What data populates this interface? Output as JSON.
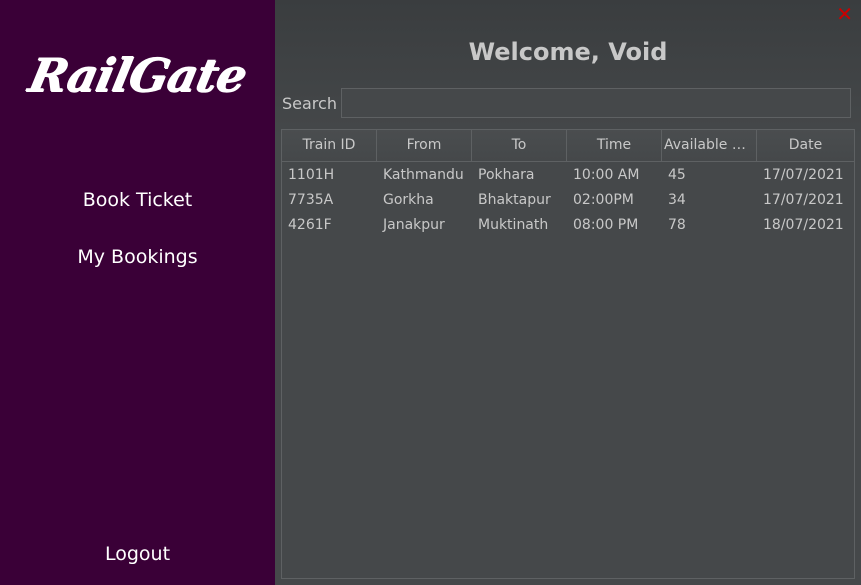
{
  "sidebar": {
    "logo": "RailGate",
    "nav": [
      "Book Ticket",
      "My Bookings"
    ],
    "logout": "Logout"
  },
  "main": {
    "welcome": "Welcome, Void",
    "search_label": "Search",
    "search_value": "",
    "close_icon": "close-icon"
  },
  "table": {
    "columns": [
      "Train ID",
      "From",
      "To",
      "Time",
      "Available Se...",
      "Date"
    ],
    "rows": [
      [
        "1101H",
        "Kathmandu",
        "Pokhara",
        "10:00 AM",
        "45",
        "17/07/2021"
      ],
      [
        "7735A",
        "Gorkha",
        "Bhaktapur",
        "02:00PM",
        "34",
        "17/07/2021"
      ],
      [
        "4261F",
        "Janakpur",
        "Muktinath",
        "08:00 PM",
        "78",
        "18/07/2021"
      ]
    ]
  },
  "colors": {
    "sidebar_bg": "#3a0037",
    "main_bg": "#45484a",
    "close": "#cc0000"
  }
}
